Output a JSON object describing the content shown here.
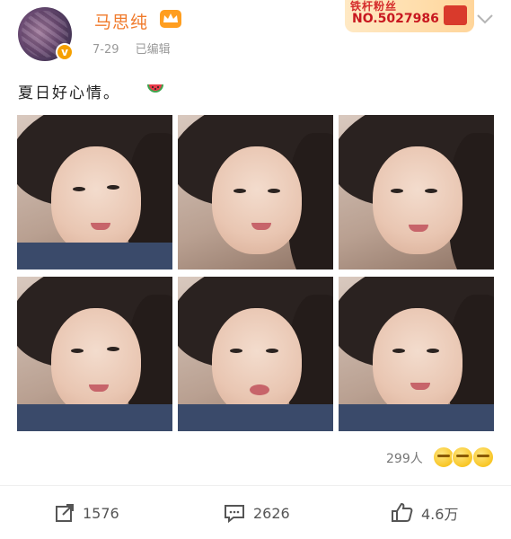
{
  "post": {
    "author": {
      "name": "马思纯",
      "verified": true,
      "crown": true
    },
    "date": "7-29",
    "edited_label": "已编辑",
    "fan_badge": {
      "title": "铁杆粉丝",
      "number": "NO.5027986"
    },
    "text": "夏日好心情。",
    "text_emoji": "watermelon",
    "photos": [
      {
        "name": "photo-1"
      },
      {
        "name": "photo-2"
      },
      {
        "name": "photo-3"
      },
      {
        "name": "photo-4"
      },
      {
        "name": "photo-5"
      },
      {
        "name": "photo-6"
      }
    ],
    "likers": {
      "count_label": "299人",
      "emoji_icons": [
        "grin-icon",
        "kiss-icon",
        "laugh-icon"
      ]
    },
    "actions": {
      "repost": {
        "icon": "share-icon",
        "count": "1576"
      },
      "comment": {
        "icon": "comment-icon",
        "count": "2626"
      },
      "like": {
        "icon": "thumbs-up-icon",
        "count": "4.6万"
      }
    }
  },
  "colors": {
    "username": "#f07a2b",
    "badge": "#f5a000",
    "fan_red": "#c8171f"
  }
}
